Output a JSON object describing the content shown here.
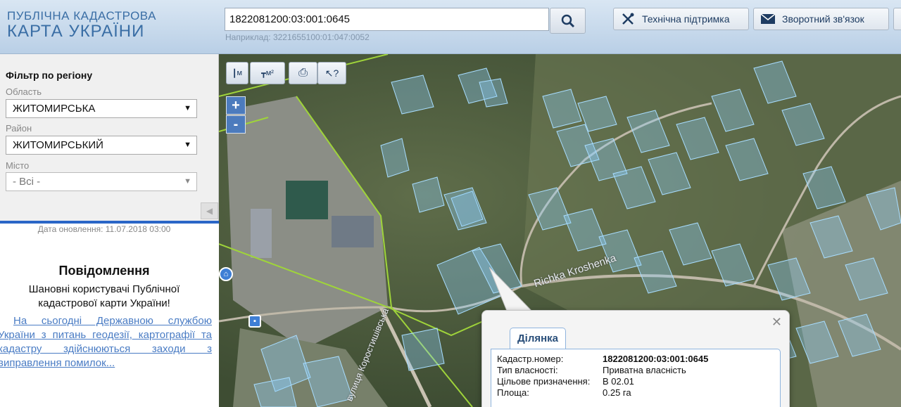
{
  "header": {
    "logo_line1": "ПУБЛІЧНА КАДАСТРОВА",
    "logo_line2": "КАРТА УКРАЇНИ",
    "search_value": "1822081200:03:001:0645",
    "search_example": "Наприклад: 3221655100:01:047:0052",
    "support_label": "Технічна підтримка",
    "feedback_label": "Зворотний зв'язок"
  },
  "filter": {
    "title": "Фільтр по регіону",
    "oblast_label": "Область",
    "oblast_value": "ЖИТОМИРСЬКА",
    "rayon_label": "Район",
    "rayon_value": "ЖИТОМИРСЬКИЙ",
    "city_label": "Місто",
    "city_value": "- Всі -"
  },
  "update_date": "Дата оновлення: 11.07.2018 03:00",
  "message": {
    "title": "Повідомлення",
    "text": "Шановні користувачі Публічної кадастрової карти України!",
    "link": "На сьогодні Державною службою України з питань геодезії, картографії та кадастру здійснюються заходи з виправлення помилок..."
  },
  "map": {
    "road_label_1": "Richka Kroshenka",
    "road_label_2": "вулиця Коростишівська",
    "tools": {
      "ruler": "м",
      "area": "м²",
      "zoom_in": "+",
      "zoom_out": "-"
    }
  },
  "popup": {
    "tab": "Ділянка",
    "rows": [
      {
        "k": "Кадастр.номер:",
        "v": "1822081200:03:001:0645"
      },
      {
        "k": "Тип власності:",
        "v": "Приватна власність"
      },
      {
        "k": "Цільове призначення:",
        "v": "В 02.01"
      },
      {
        "k": "Площа:",
        "v": "0.25 га"
      }
    ]
  },
  "colors": {
    "accent": "#3a6ea5",
    "parcel": "#8fd0ff",
    "boundary": "#9fd43a",
    "link": "#4a7cc4"
  }
}
